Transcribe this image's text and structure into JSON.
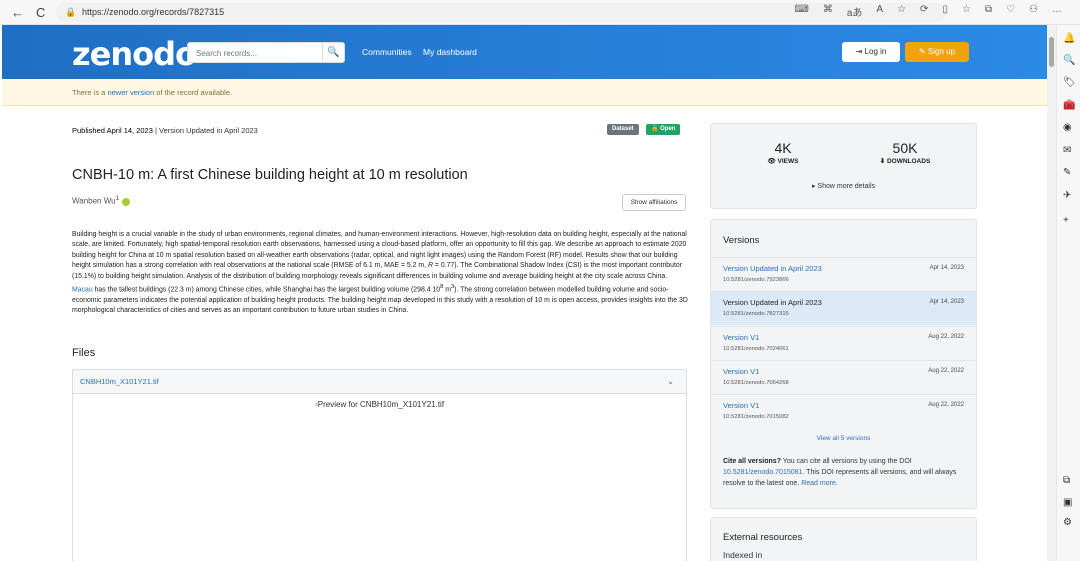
{
  "browser": {
    "url": "https://zenodo.org/records/7827315",
    "back": "←",
    "reload": "C",
    "toolbar_icons": [
      "⌨",
      "⌘",
      "aあ",
      "A",
      "☆",
      "⟳",
      "▯",
      "☆",
      "⧉",
      "♡",
      "⚇",
      "…"
    ]
  },
  "edge_sidebar": [
    "🔔",
    "🔍",
    "🏷",
    "🧰",
    "◉",
    "✉",
    "✎",
    "✈",
    "+",
    "⧉",
    "▣",
    "⚙"
  ],
  "header": {
    "logo": "zenodo",
    "search_placeholder": "Search records...",
    "search_icon": "🔍",
    "links": [
      "Communities",
      "My dashboard"
    ],
    "login": "⇥ Log in",
    "signup": "✎ Sign up"
  },
  "notice": {
    "pre": "There is a ",
    "link": "newer version",
    "post": " of the record available."
  },
  "record": {
    "published": "Published April 14, 2023",
    "version_updated": " | Version Updated in April 2023",
    "badge_dataset": "Dataset",
    "badge_open": "🔓 Open",
    "title": "CNBH-10 m: A first Chinese building height at 10 m resolution",
    "author": "Wanben Wu",
    "author_sup": "1",
    "show_affiliations": "Show affiliations",
    "abstract_1": "Building height is a crucial variable in the study of urban environments, regional climates, and human-environment interactions. However, high-resolution data on building height, especially at the national scale, are limited. Fortunately, high spatial-temporal resolution earth observations, harnessed using a cloud-based platform, offer an opportunity to fill this gap. We describe an approach to estimate 2020 building height for China at 10 m spatial resolution based on all-weather earth observations (radar, optical, and night light images) using the Random Forest (RF) model. Results show that our building height simulation has a strong correlation with real observations at the national scale (RMSE of 6.1 m, MAE = 5.2 m, ",
    "abstract_r": "R",
    "abstract_2": " = 0.77). The Combinational Shadow Index (CSI) is the most important contributor (15.1%) to building height simulation. Analysis of the distribution of building morphology reveals significant differences in building volume and average building height at the city scale across China. ",
    "abstract_link": "Macau",
    "abstract_3": " has the tallest buildings (22.3 m) among Chinese cities, while Shanghai has the largest building volume (298.4 10",
    "abstract_sup1": "8",
    "abstract_4": " m",
    "abstract_sup2": "3",
    "abstract_5": "). The strong correlation between modelled building volume and socio-economic parameters indicates the potential application of building height products. The building height map developed in this study with a resolution of 10 m is open access, provides insights into the 3D morphological characteristics of cities and serves as an important contribution to future urban studies in China."
  },
  "files": {
    "heading": "Files",
    "file_name": "CNBH10m_X101Y21.tif",
    "preview_alt": "Preview for CNBH10m_X101Y21.tif"
  },
  "stats": {
    "views_count": "4K",
    "views_label": "👁 VIEWS",
    "downloads_count": "50K",
    "downloads_label": "⬇ DOWNLOADS",
    "show_more": "▸ Show more details"
  },
  "versions": {
    "heading": "Versions",
    "items": [
      {
        "title": "Version Updated in April 2023",
        "date": "Apr 14, 2023",
        "doi": "10.5281/zenodo.7923866"
      },
      {
        "title": "Version Updated in April 2023",
        "date": "Apr 14, 2023",
        "doi": "10.5281/zenodo.7827315"
      },
      {
        "title": "Version V1",
        "date": "Aug 22, 2022",
        "doi": "10.5281/zenodo.7024061"
      },
      {
        "title": "Version V1",
        "date": "Aug 22, 2022",
        "doi": "10.5281/zenodo.7064268"
      },
      {
        "title": "Version V1",
        "date": "Aug 22, 2022",
        "doi": "10.5281/zenodo.7015082"
      }
    ],
    "view_all": "View all 5 versions",
    "cite_bold": "Cite all versions?",
    "cite_pre": " You can cite all versions by using the DOI ",
    "cite_doi": "10.5281/zenodo.7015081",
    "cite_post": ". This DOI represents all versions, and will always resolve to the latest one. ",
    "read_more": "Read more."
  },
  "external": {
    "heading": "External resources",
    "sub": "Indexed in"
  },
  "colors": {
    "brand": "#2b8ae6",
    "signup": "#f0a30a",
    "dataset_badge": "#6c757d",
    "open_badge": "#21a366"
  }
}
